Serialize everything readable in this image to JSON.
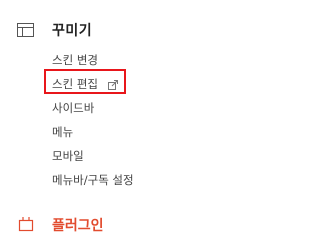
{
  "section": {
    "title": "꾸미기",
    "icon": "layout-icon"
  },
  "menu": {
    "items": [
      {
        "label": "스킨 변경"
      },
      {
        "label": "스킨 편집",
        "icon": "external-link-icon",
        "highlighted": true
      },
      {
        "label": "사이드바"
      },
      {
        "label": "메뉴"
      },
      {
        "label": "모바일"
      },
      {
        "label": "메뉴바/구독 설정"
      }
    ]
  },
  "next_section": {
    "title": "플러그인",
    "icon": "plugin-icon",
    "color": "#e24b2e"
  },
  "colors": {
    "highlight_border": "#e8161b",
    "text": "#444444",
    "title": "#222222"
  }
}
